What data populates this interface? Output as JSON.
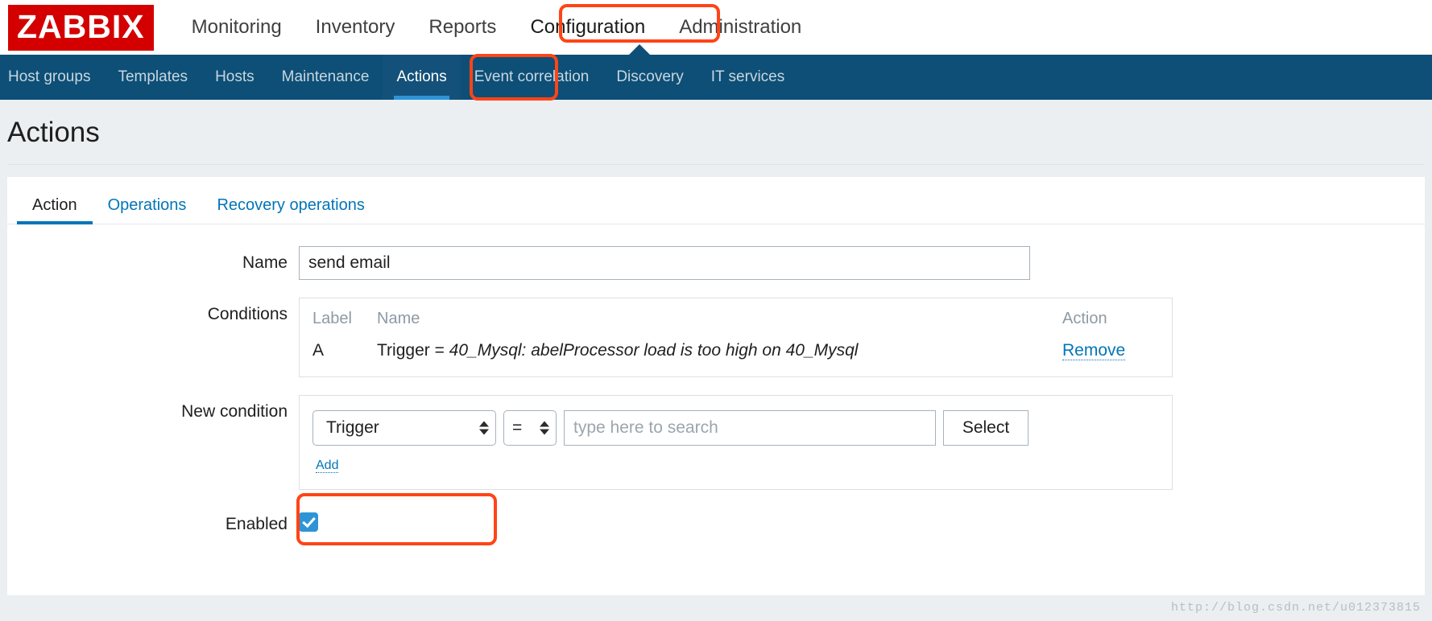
{
  "brand": {
    "name": "ZABBIX",
    "logo_bg": "#d40000"
  },
  "main_nav": {
    "items": [
      {
        "label": "Monitoring",
        "selected": false
      },
      {
        "label": "Inventory",
        "selected": false
      },
      {
        "label": "Reports",
        "selected": false
      },
      {
        "label": "Configuration",
        "selected": true
      },
      {
        "label": "Administration",
        "selected": false
      }
    ]
  },
  "sub_nav": {
    "bg": "#0d4f76",
    "active_underline": "#2e94d6",
    "items": [
      {
        "label": "Host groups",
        "active": false
      },
      {
        "label": "Templates",
        "active": false
      },
      {
        "label": "Hosts",
        "active": false
      },
      {
        "label": "Maintenance",
        "active": false
      },
      {
        "label": "Actions",
        "active": true
      },
      {
        "label": "Event correlation",
        "active": false
      },
      {
        "label": "Discovery",
        "active": false
      },
      {
        "label": "IT services",
        "active": false
      }
    ]
  },
  "page": {
    "title": "Actions"
  },
  "tabs": [
    {
      "label": "Action",
      "active": true
    },
    {
      "label": "Operations",
      "active": false
    },
    {
      "label": "Recovery operations",
      "active": false
    }
  ],
  "form": {
    "name": {
      "label": "Name",
      "value": "send email",
      "placeholder": ""
    },
    "conditions": {
      "label": "Conditions",
      "headers": {
        "label": "Label",
        "name": "Name",
        "action": "Action"
      },
      "rows": [
        {
          "label": "A",
          "prefix": "Trigger = ",
          "name": "40_Mysql: abelProcessor load is too high on 40_Mysql",
          "action": "Remove"
        }
      ]
    },
    "new_condition": {
      "label": "New condition",
      "type_value": "Trigger",
      "operator_value": "=",
      "search_placeholder": "type here to search",
      "search_value": "",
      "select_button": "Select",
      "add_link": "Add"
    },
    "enabled": {
      "label": "Enabled",
      "checked": true,
      "accent": "#2e94d6"
    }
  },
  "annotations": {
    "highlight_color": "#ff4417",
    "targets": [
      "Configuration",
      "Actions",
      "Trigger type select"
    ]
  },
  "watermark": "http://blog.csdn.net/u012373815"
}
